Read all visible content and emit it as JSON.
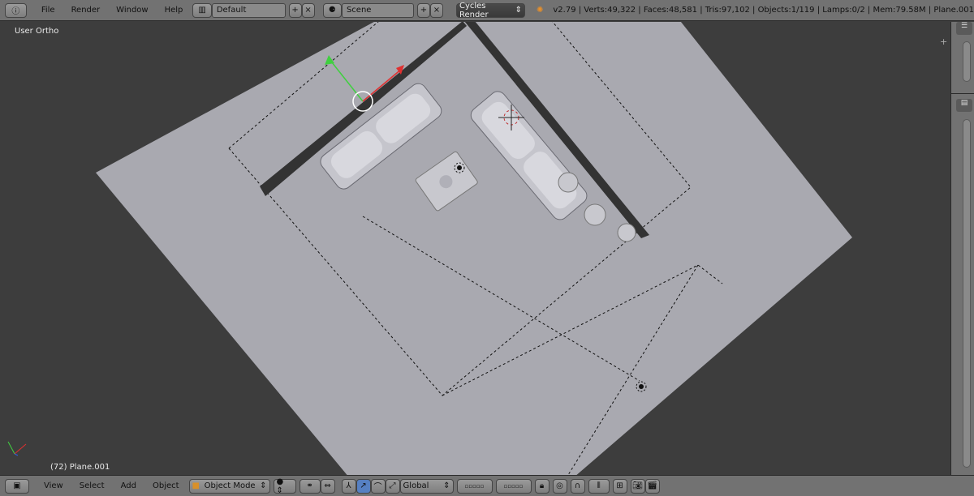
{
  "topbar": {
    "info_icon": "info-icon",
    "menus": [
      "File",
      "Render",
      "Window",
      "Help"
    ],
    "layout": "Default",
    "scene": "Scene",
    "render_engine": "Cycles Render",
    "stats": "v2.79 | Verts:49,322 | Faces:48,581 | Tris:97,102 | Objects:1/119 | Lamps:0/2 | Mem:79.58M | Plane.001"
  },
  "viewport": {
    "view_name": "User Ortho",
    "active_object": "(72) Plane.001"
  },
  "bottombar": {
    "menus": [
      "View",
      "Select",
      "Add",
      "Object"
    ],
    "mode": "Object Mode",
    "orientation": "Global"
  },
  "colors": {
    "header": "#727272",
    "viewport_bg": "#3d3d3d",
    "plane": "#a9a9b0",
    "x_axis": "#e03030",
    "y_axis": "#40d040"
  }
}
